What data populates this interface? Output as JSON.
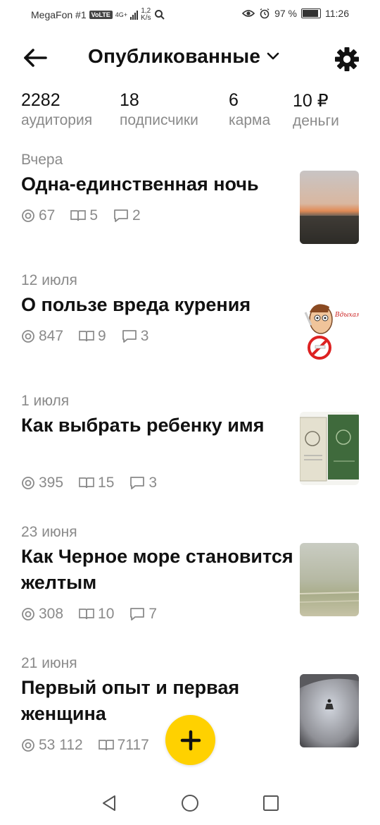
{
  "status_bar": {
    "carrier": "MegaFon #1",
    "volte": "VoLTE",
    "network": "4G+",
    "speed_value": "1,2",
    "speed_unit": "K/s",
    "battery": "97 %",
    "time": "11:26"
  },
  "header": {
    "title": "Опубликованные"
  },
  "stats": [
    {
      "value": "2282",
      "label": "аудитория"
    },
    {
      "value": "18",
      "label": "подписчики"
    },
    {
      "value": "6",
      "label": "карма"
    },
    {
      "value": "10 ₽",
      "label": "деньги"
    }
  ],
  "posts": [
    {
      "date": "Вчера",
      "title": "Одна-единственная ночь",
      "views": "67",
      "reads": "5",
      "comments": "2"
    },
    {
      "date": "12 июля",
      "title": "О пользе вреда курения",
      "views": "847",
      "reads": "9",
      "comments": "3",
      "thumb_text": "Вдыхая выдыхая"
    },
    {
      "date": "1 июля",
      "title": "Как выбрать ребенку имя",
      "views": "395",
      "reads": "15",
      "comments": "3"
    },
    {
      "date": "23 июня",
      "title": "Как Черное море становится желтым",
      "views": "308",
      "reads": "10",
      "comments": "7"
    },
    {
      "date": "21 июня",
      "title": "Первый опыт и первая женщина",
      "views": "53 112",
      "reads": "7117",
      "comments": ""
    }
  ],
  "colors": {
    "accent": "#ffd100",
    "muted": "#8a8a8a",
    "text": "#111111"
  },
  "icons": [
    "back-arrow-icon",
    "chevron-down-icon",
    "gear-icon",
    "views-icon",
    "reads-icon",
    "comments-icon",
    "plus-icon"
  ]
}
